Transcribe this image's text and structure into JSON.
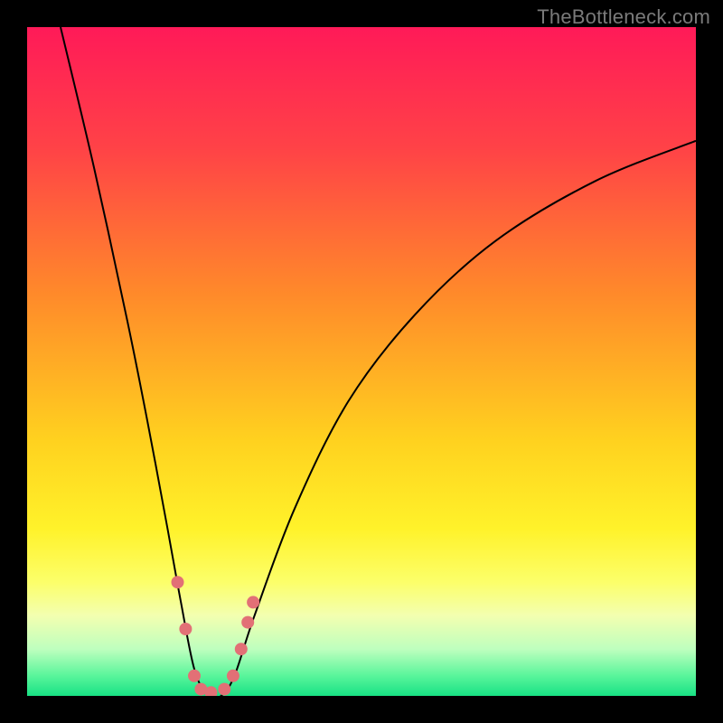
{
  "watermark": "TheBottleneck.com",
  "chart_data": {
    "type": "line",
    "title": "",
    "xlabel": "",
    "ylabel": "",
    "xlim": [
      0,
      100
    ],
    "ylim": [
      0,
      100
    ],
    "grid": false,
    "series": [
      {
        "name": "bottleneck-curve",
        "x": [
          5,
          10,
          15,
          18,
          21,
          23,
          25,
          27,
          29,
          31,
          34,
          40,
          48,
          58,
          70,
          85,
          100
        ],
        "y": [
          100,
          79,
          56,
          41,
          25,
          14,
          4,
          0,
          0,
          3,
          12,
          28,
          44,
          57,
          68,
          77,
          83
        ]
      }
    ],
    "markers": {
      "name": "curve-dots",
      "color": "#e27076",
      "points": [
        {
          "x": 22.5,
          "y": 17
        },
        {
          "x": 23.7,
          "y": 10
        },
        {
          "x": 25.0,
          "y": 3
        },
        {
          "x": 26.0,
          "y": 1
        },
        {
          "x": 27.5,
          "y": 0.5
        },
        {
          "x": 29.5,
          "y": 1
        },
        {
          "x": 30.8,
          "y": 3
        },
        {
          "x": 32.0,
          "y": 7
        },
        {
          "x": 33.0,
          "y": 11
        },
        {
          "x": 33.8,
          "y": 14
        }
      ]
    },
    "background_gradient": {
      "stops": [
        {
          "pct": 0,
          "color": "#ff1a58"
        },
        {
          "pct": 18,
          "color": "#ff4247"
        },
        {
          "pct": 40,
          "color": "#ff8a2a"
        },
        {
          "pct": 62,
          "color": "#ffd21f"
        },
        {
          "pct": 75,
          "color": "#fff22a"
        },
        {
          "pct": 83,
          "color": "#fcff6a"
        },
        {
          "pct": 88,
          "color": "#f3ffb0"
        },
        {
          "pct": 93,
          "color": "#beffbe"
        },
        {
          "pct": 97,
          "color": "#59f59b"
        },
        {
          "pct": 100,
          "color": "#18e184"
        }
      ]
    }
  }
}
